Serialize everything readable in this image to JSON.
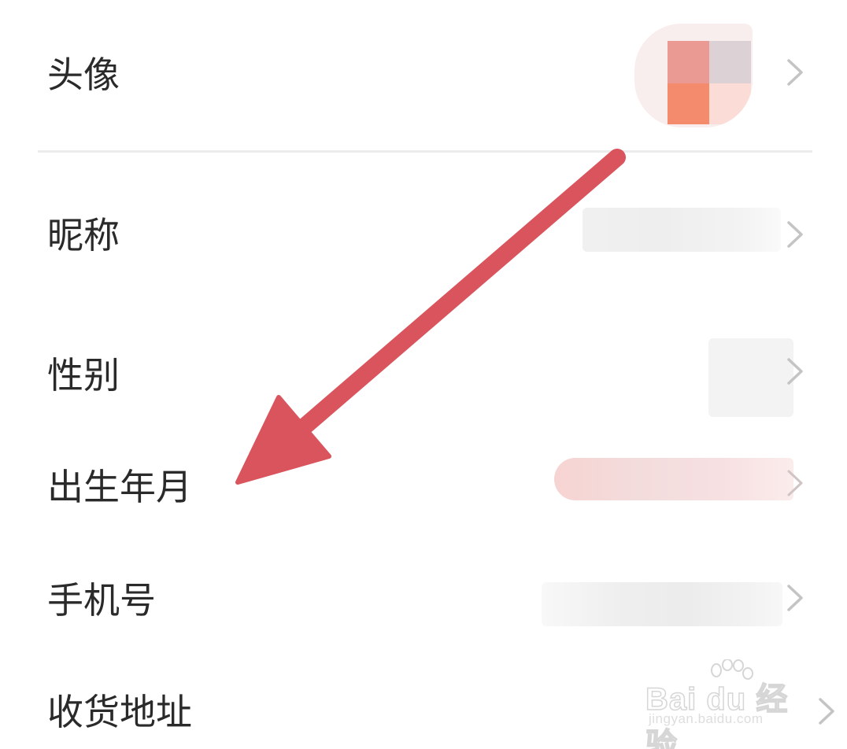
{
  "rows": [
    {
      "key": "avatar",
      "label": "头像"
    },
    {
      "key": "nickname",
      "label": "昵称"
    },
    {
      "key": "gender",
      "label": "性别"
    },
    {
      "key": "birthdate",
      "label": "出生年月"
    },
    {
      "key": "phone",
      "label": "手机号"
    },
    {
      "key": "address",
      "label": "收货地址"
    }
  ],
  "annotation": {
    "arrow_color": "#d9545c",
    "points_to": "出生年月"
  },
  "watermark": {
    "logo_text": "Bai du 经验",
    "url": "jingyan.baidu.com"
  },
  "colors": {
    "text": "#2a2a2a",
    "chevron": "#c4c4c4",
    "divider": "#ececec"
  }
}
